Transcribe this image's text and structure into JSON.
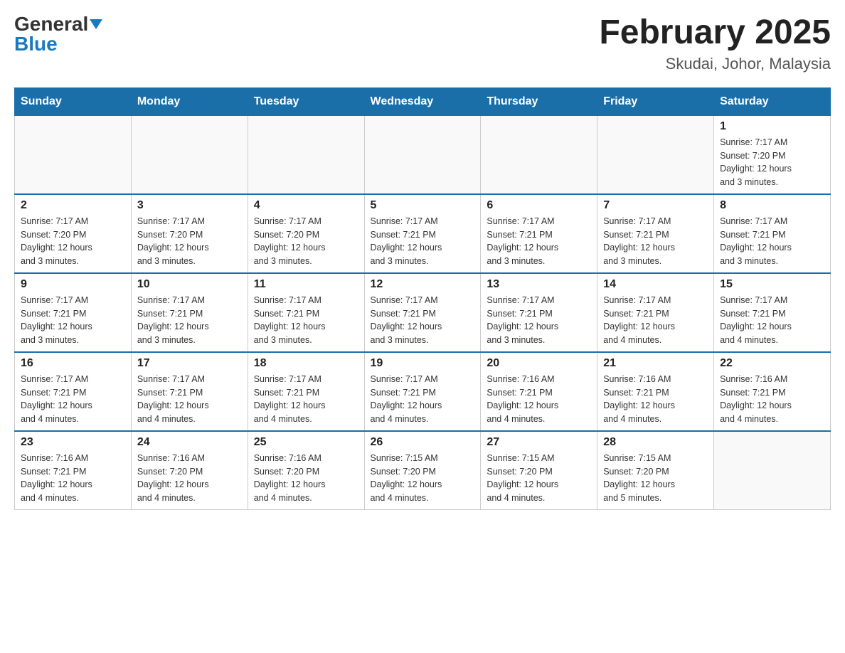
{
  "header": {
    "logo_general": "General",
    "logo_blue": "Blue",
    "month_title": "February 2025",
    "location": "Skudai, Johor, Malaysia"
  },
  "weekdays": [
    "Sunday",
    "Monday",
    "Tuesday",
    "Wednesday",
    "Thursday",
    "Friday",
    "Saturday"
  ],
  "weeks": [
    [
      {
        "day": "",
        "info": ""
      },
      {
        "day": "",
        "info": ""
      },
      {
        "day": "",
        "info": ""
      },
      {
        "day": "",
        "info": ""
      },
      {
        "day": "",
        "info": ""
      },
      {
        "day": "",
        "info": ""
      },
      {
        "day": "1",
        "info": "Sunrise: 7:17 AM\nSunset: 7:20 PM\nDaylight: 12 hours\nand 3 minutes."
      }
    ],
    [
      {
        "day": "2",
        "info": "Sunrise: 7:17 AM\nSunset: 7:20 PM\nDaylight: 12 hours\nand 3 minutes."
      },
      {
        "day": "3",
        "info": "Sunrise: 7:17 AM\nSunset: 7:20 PM\nDaylight: 12 hours\nand 3 minutes."
      },
      {
        "day": "4",
        "info": "Sunrise: 7:17 AM\nSunset: 7:20 PM\nDaylight: 12 hours\nand 3 minutes."
      },
      {
        "day": "5",
        "info": "Sunrise: 7:17 AM\nSunset: 7:21 PM\nDaylight: 12 hours\nand 3 minutes."
      },
      {
        "day": "6",
        "info": "Sunrise: 7:17 AM\nSunset: 7:21 PM\nDaylight: 12 hours\nand 3 minutes."
      },
      {
        "day": "7",
        "info": "Sunrise: 7:17 AM\nSunset: 7:21 PM\nDaylight: 12 hours\nand 3 minutes."
      },
      {
        "day": "8",
        "info": "Sunrise: 7:17 AM\nSunset: 7:21 PM\nDaylight: 12 hours\nand 3 minutes."
      }
    ],
    [
      {
        "day": "9",
        "info": "Sunrise: 7:17 AM\nSunset: 7:21 PM\nDaylight: 12 hours\nand 3 minutes."
      },
      {
        "day": "10",
        "info": "Sunrise: 7:17 AM\nSunset: 7:21 PM\nDaylight: 12 hours\nand 3 minutes."
      },
      {
        "day": "11",
        "info": "Sunrise: 7:17 AM\nSunset: 7:21 PM\nDaylight: 12 hours\nand 3 minutes."
      },
      {
        "day": "12",
        "info": "Sunrise: 7:17 AM\nSunset: 7:21 PM\nDaylight: 12 hours\nand 3 minutes."
      },
      {
        "day": "13",
        "info": "Sunrise: 7:17 AM\nSunset: 7:21 PM\nDaylight: 12 hours\nand 3 minutes."
      },
      {
        "day": "14",
        "info": "Sunrise: 7:17 AM\nSunset: 7:21 PM\nDaylight: 12 hours\nand 4 minutes."
      },
      {
        "day": "15",
        "info": "Sunrise: 7:17 AM\nSunset: 7:21 PM\nDaylight: 12 hours\nand 4 minutes."
      }
    ],
    [
      {
        "day": "16",
        "info": "Sunrise: 7:17 AM\nSunset: 7:21 PM\nDaylight: 12 hours\nand 4 minutes."
      },
      {
        "day": "17",
        "info": "Sunrise: 7:17 AM\nSunset: 7:21 PM\nDaylight: 12 hours\nand 4 minutes."
      },
      {
        "day": "18",
        "info": "Sunrise: 7:17 AM\nSunset: 7:21 PM\nDaylight: 12 hours\nand 4 minutes."
      },
      {
        "day": "19",
        "info": "Sunrise: 7:17 AM\nSunset: 7:21 PM\nDaylight: 12 hours\nand 4 minutes."
      },
      {
        "day": "20",
        "info": "Sunrise: 7:16 AM\nSunset: 7:21 PM\nDaylight: 12 hours\nand 4 minutes."
      },
      {
        "day": "21",
        "info": "Sunrise: 7:16 AM\nSunset: 7:21 PM\nDaylight: 12 hours\nand 4 minutes."
      },
      {
        "day": "22",
        "info": "Sunrise: 7:16 AM\nSunset: 7:21 PM\nDaylight: 12 hours\nand 4 minutes."
      }
    ],
    [
      {
        "day": "23",
        "info": "Sunrise: 7:16 AM\nSunset: 7:21 PM\nDaylight: 12 hours\nand 4 minutes."
      },
      {
        "day": "24",
        "info": "Sunrise: 7:16 AM\nSunset: 7:20 PM\nDaylight: 12 hours\nand 4 minutes."
      },
      {
        "day": "25",
        "info": "Sunrise: 7:16 AM\nSunset: 7:20 PM\nDaylight: 12 hours\nand 4 minutes."
      },
      {
        "day": "26",
        "info": "Sunrise: 7:15 AM\nSunset: 7:20 PM\nDaylight: 12 hours\nand 4 minutes."
      },
      {
        "day": "27",
        "info": "Sunrise: 7:15 AM\nSunset: 7:20 PM\nDaylight: 12 hours\nand 4 minutes."
      },
      {
        "day": "28",
        "info": "Sunrise: 7:15 AM\nSunset: 7:20 PM\nDaylight: 12 hours\nand 5 minutes."
      },
      {
        "day": "",
        "info": ""
      }
    ]
  ]
}
